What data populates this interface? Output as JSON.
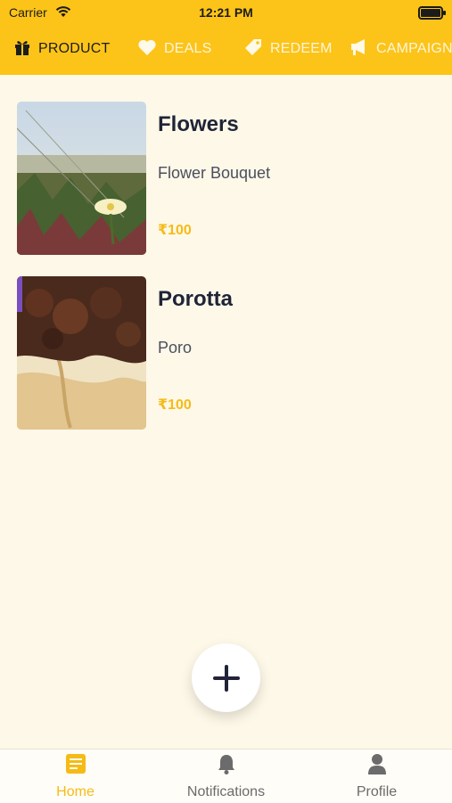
{
  "status_bar": {
    "carrier": "Carrier",
    "time": "12:21 PM",
    "icons": [
      "wifi-icon",
      "battery-icon"
    ]
  },
  "tabs": [
    {
      "label": "PRODUCT",
      "icon": "gift-icon",
      "active": true
    },
    {
      "label": "DEALS",
      "icon": "heart-icon",
      "active": false
    },
    {
      "label": "REDEEM",
      "icon": "tag-icon",
      "active": false
    },
    {
      "label": "CAMPAIGN",
      "icon": "megaphone-icon",
      "active": false
    }
  ],
  "products": [
    {
      "title": "Flowers",
      "subtitle": "Flower Bouquet",
      "price": "₹100",
      "image": "flower-photo"
    },
    {
      "title": "Porotta",
      "subtitle": "Poro",
      "price": "₹100",
      "image": "porotta-photo"
    }
  ],
  "fab": {
    "icon": "plus-icon"
  },
  "bottom_nav": [
    {
      "label": "Home",
      "icon": "home-document-icon",
      "active": true
    },
    {
      "label": "Notifications",
      "icon": "bell-icon",
      "active": false
    },
    {
      "label": "Profile",
      "icon": "person-icon",
      "active": false
    }
  ],
  "colors": {
    "header": "#fcc419",
    "background": "#fef8e8",
    "accent": "#f5bb16",
    "title": "#1f2437"
  }
}
